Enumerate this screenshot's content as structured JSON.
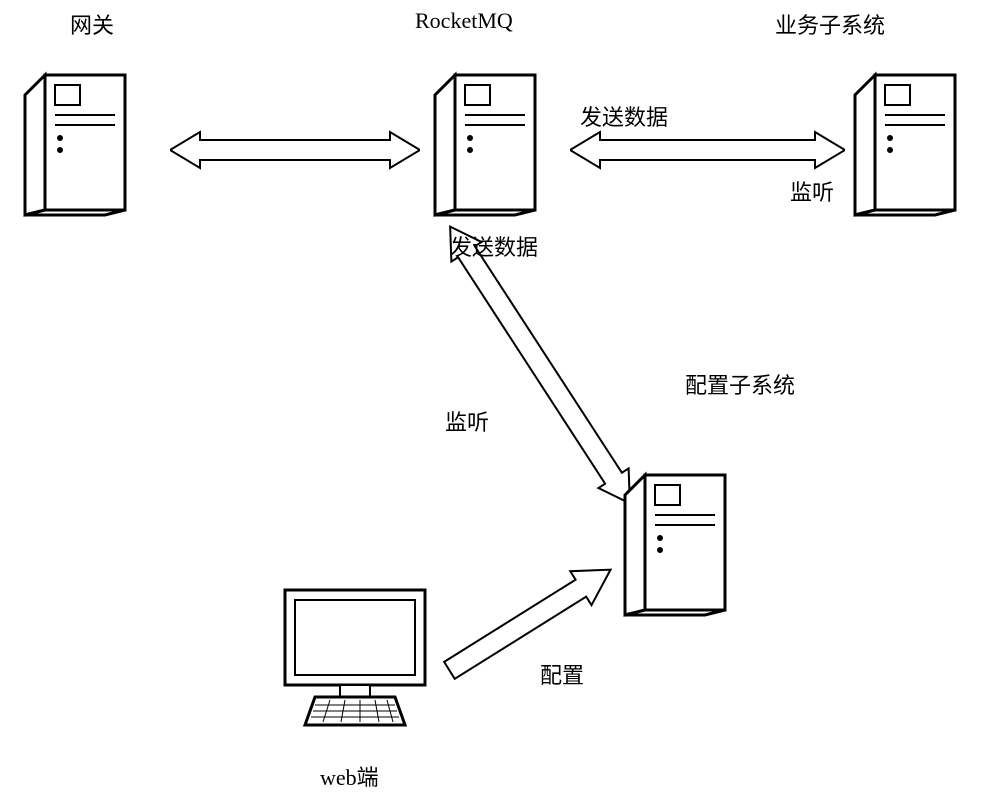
{
  "labels": {
    "gateway": "网关",
    "rocketmq": "RocketMQ",
    "businessSubsystem": "业务子系统",
    "sendData1": "发送数据",
    "listen1": "监听",
    "sendData2": "发送数据",
    "listen2": "监听",
    "configSubsystem": "配置子系统",
    "config": "配置",
    "webEnd": "web端"
  }
}
